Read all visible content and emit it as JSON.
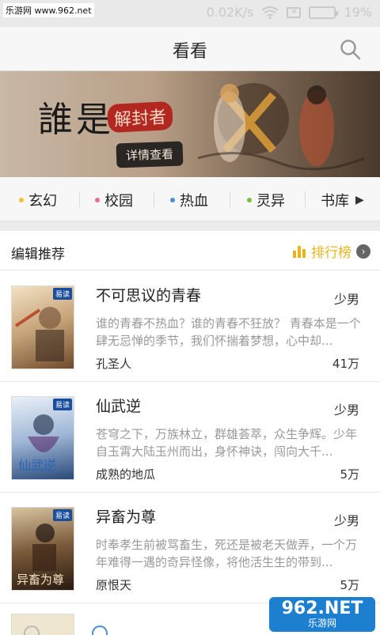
{
  "status_bar": {
    "watermark": "乐游网 www.962.net",
    "network_speed": "0.02K/s",
    "battery": "19%",
    "icons": [
      "wifi-icon",
      "sim-icon",
      "battery-icon"
    ]
  },
  "header": {
    "title": "看看",
    "search_icon": "search-icon"
  },
  "banner": {
    "title": "誰是",
    "subtitle": "解封者",
    "detail_button": "详情查看"
  },
  "categories": [
    {
      "label": "玄幻",
      "dot_color": "#f1c232"
    },
    {
      "label": "校园",
      "dot_color": "#e86f8c"
    },
    {
      "label": "热血",
      "dot_color": "#4a90d9"
    },
    {
      "label": "灵异",
      "dot_color": "#7bc043"
    },
    {
      "label": "书库",
      "arrow": "▶"
    }
  ],
  "section": {
    "title": "编辑推荐",
    "rank_label": "排行榜",
    "rank_icon": "bar-chart-icon",
    "accent_color": "#e8b51c"
  },
  "books": [
    {
      "title": "不可思议的青春",
      "category": "少男",
      "description": "谁的青春不热血？谁的青春不狂放？ 青春本是一个肆无忌惮的季节，我们怀揣着梦想，心中却...",
      "author": "孔圣人",
      "count": "41万"
    },
    {
      "title": "仙武逆",
      "category": "少男",
      "description": "苍穹之下，万族林立，群雄荟萃，众生争辉。少年自玉霄大陆玉州而出，身怀神诀，闯向大千...",
      "author": "成熟的地瓜",
      "count": "5万"
    },
    {
      "title": "异畜为尊",
      "category": "少男",
      "description": "时奉孝生前被骂畜生，死还是被老天做弄，一个万年难得一遇的奇异怪像，将他活生生的带到...",
      "author": "原恨天",
      "count": "5万"
    }
  ],
  "watermark_bottom": {
    "big": "962.NET",
    "small": "乐游网"
  }
}
